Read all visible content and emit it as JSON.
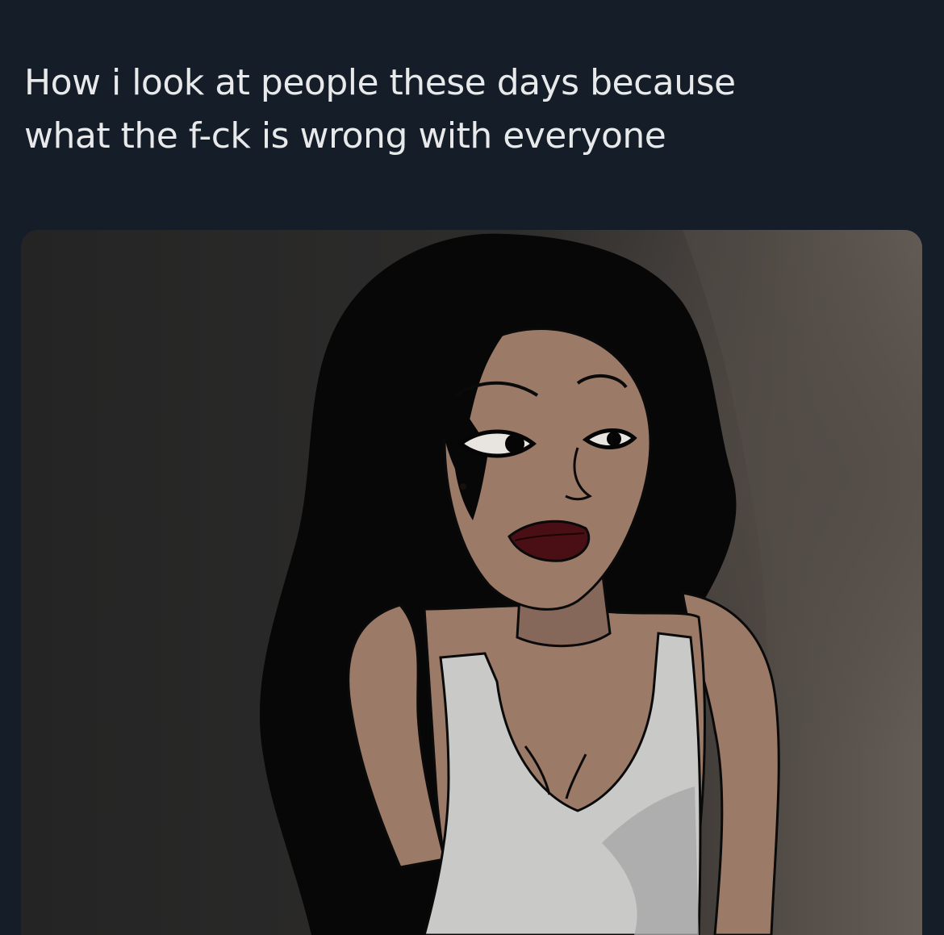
{
  "tweet": {
    "text_line_1": "How i look at people these days because",
    "text_line_2": "what the f-ck is wrong with everyone"
  },
  "media": {
    "subject": "cartoon woman with long black hair in white tank top glancing sideways",
    "colors": {
      "page_background": "#151d28",
      "text": "#e7e9ea",
      "wall_dark": "#262626",
      "wall_light": "#5e5650",
      "hair": "#070707",
      "skin": "#9b7a67",
      "skin_shadow": "#7a5c4c",
      "tank_top": "#c9c9c7",
      "lips": "#4a0f14"
    }
  }
}
